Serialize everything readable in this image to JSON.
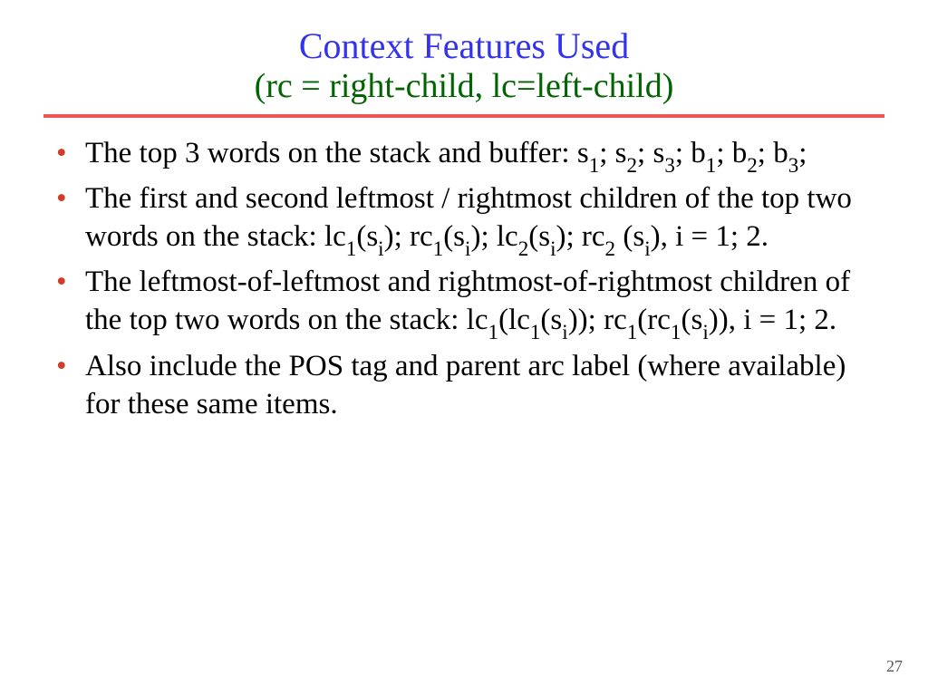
{
  "title": "Context Features Used",
  "subtitle": "(rc = right-child, lc=left-child)",
  "bullets": [
    {
      "runs": [
        {
          "t": "The top 3 words on the stack and buffer: s"
        },
        {
          "t": "1",
          "sub": true
        },
        {
          "t": "; s"
        },
        {
          "t": "2",
          "sub": true
        },
        {
          "t": "; s"
        },
        {
          "t": "3",
          "sub": true
        },
        {
          "t": "; b"
        },
        {
          "t": "1",
          "sub": true
        },
        {
          "t": "; b"
        },
        {
          "t": "2",
          "sub": true
        },
        {
          "t": "; b"
        },
        {
          "t": "3",
          "sub": true
        },
        {
          "t": ";"
        }
      ]
    },
    {
      "runs": [
        {
          "t": "The first and second leftmost / rightmost children of the top two words on the stack: lc"
        },
        {
          "t": "1",
          "sub": true
        },
        {
          "t": "(s"
        },
        {
          "t": "i",
          "sub": true
        },
        {
          "t": "); rc"
        },
        {
          "t": "1",
          "sub": true
        },
        {
          "t": "(s"
        },
        {
          "t": "i",
          "sub": true
        },
        {
          "t": "); lc"
        },
        {
          "t": "2",
          "sub": true
        },
        {
          "t": "(s"
        },
        {
          "t": "i",
          "sub": true
        },
        {
          "t": "); rc"
        },
        {
          "t": "2",
          "sub": true
        },
        {
          "t": " (s"
        },
        {
          "t": "i",
          "sub": true
        },
        {
          "t": "), i = 1; 2."
        }
      ]
    },
    {
      "runs": [
        {
          "t": "The leftmost-of-leftmost and rightmost-of-rightmost children of the top two words on the stack: lc"
        },
        {
          "t": "1",
          "sub": true
        },
        {
          "t": "(lc"
        },
        {
          "t": "1",
          "sub": true
        },
        {
          "t": "(s"
        },
        {
          "t": "i",
          "sub": true
        },
        {
          "t": ")); rc"
        },
        {
          "t": "1",
          "sub": true
        },
        {
          "t": "(rc"
        },
        {
          "t": "1",
          "sub": true
        },
        {
          "t": "(s"
        },
        {
          "t": "i",
          "sub": true
        },
        {
          "t": ")), i = 1; 2."
        }
      ]
    },
    {
      "runs": [
        {
          "t": "Also include the POS tag and parent arc label (where available) for these same items."
        }
      ]
    }
  ],
  "slide_number": "27"
}
